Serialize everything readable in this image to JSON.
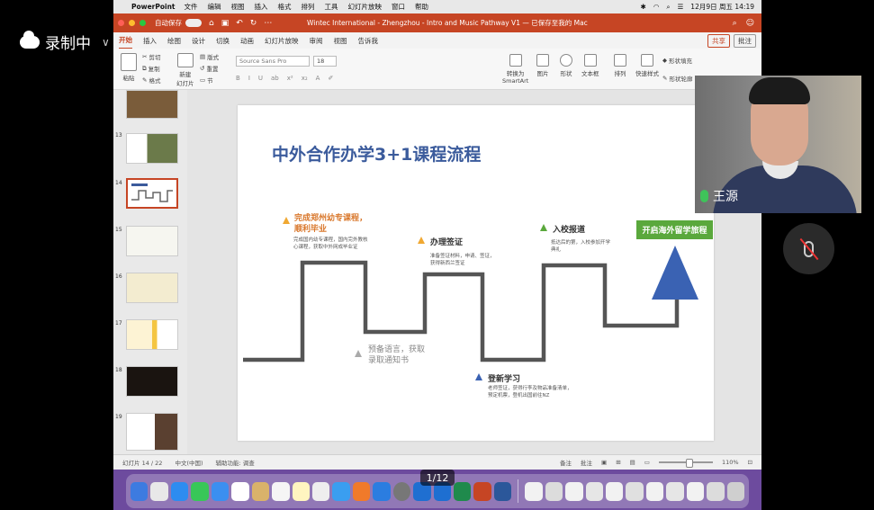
{
  "recording": {
    "label": "录制中"
  },
  "menubar": {
    "app": "PowerPoint",
    "items": [
      "文件",
      "编辑",
      "视图",
      "插入",
      "格式",
      "排列",
      "工具",
      "幻灯片放映",
      "窗口",
      "帮助"
    ],
    "clock": "12月9日 周五 14:19"
  },
  "titlebar": {
    "autosave": "自动保存",
    "toggle": "关闭",
    "title": "Wintec International - Zhengzhou - Intro and Music Pathway V1 — 已保存至我的 Mac"
  },
  "ribbon_tabs": {
    "tabs": [
      "开始",
      "插入",
      "绘图",
      "设计",
      "切换",
      "动画",
      "幻灯片放映",
      "审阅",
      "视图",
      "告诉我"
    ],
    "share": "共享",
    "comment": "批注"
  },
  "ribbon": {
    "paste": "粘贴",
    "cut": "剪切",
    "copy": "复制",
    "format": "格式",
    "new_slide": "新建\n幻灯片",
    "layout": "版式",
    "reset": "重置",
    "section": "节",
    "font": "Source Sans Pro",
    "size": "18",
    "convert_smartart": "转换为\nSmartArt",
    "picture": "图片",
    "shape": "形状",
    "textbox": "文本框",
    "arrange": "排列",
    "quick_styles": "快速样式",
    "shape_fill": "形状填充",
    "shape_outline": "形状轮廓"
  },
  "thumbnails": [
    "13",
    "14",
    "15",
    "16",
    "17",
    "18",
    "19"
  ],
  "slide": {
    "title": "中外合作办学3+1课程流程",
    "step1_title": "完成郑州幼专课程，\n顺利毕业",
    "step1_desc": "完成国内幼专课程，国内完外教核\n心课程，获取中外网成毕业证",
    "step2_title": "预备语言，获取\n录取通知书",
    "step3_title": "办理签证",
    "step3_desc": "准备签证材料，申请、签证，\n获得新西兰签证",
    "step4_title": "登新学习",
    "step4_desc": "老师签证，获得行李及物品准备清单，\n预定机票，登机出国前往NZ",
    "step5_title": "入校报道",
    "step5_desc": "抵达后的第，入校参加开学\n典礼",
    "goal": "开启海外留学旅程"
  },
  "status": {
    "slide_info": "幻灯片 14 / 22",
    "language": "中文(中国)",
    "accessibility": "辅助功能: 调查",
    "notes": "备注",
    "comments": "批注",
    "zoom": "110%"
  },
  "page_indicator": "1/12",
  "video": {
    "name": "王源"
  },
  "colors": {
    "accent": "#c64524",
    "title_blue": "#3b5b9c",
    "orange": "#d9772b",
    "green": "#5aa83c",
    "blue_triangle": "#3a62b3"
  }
}
